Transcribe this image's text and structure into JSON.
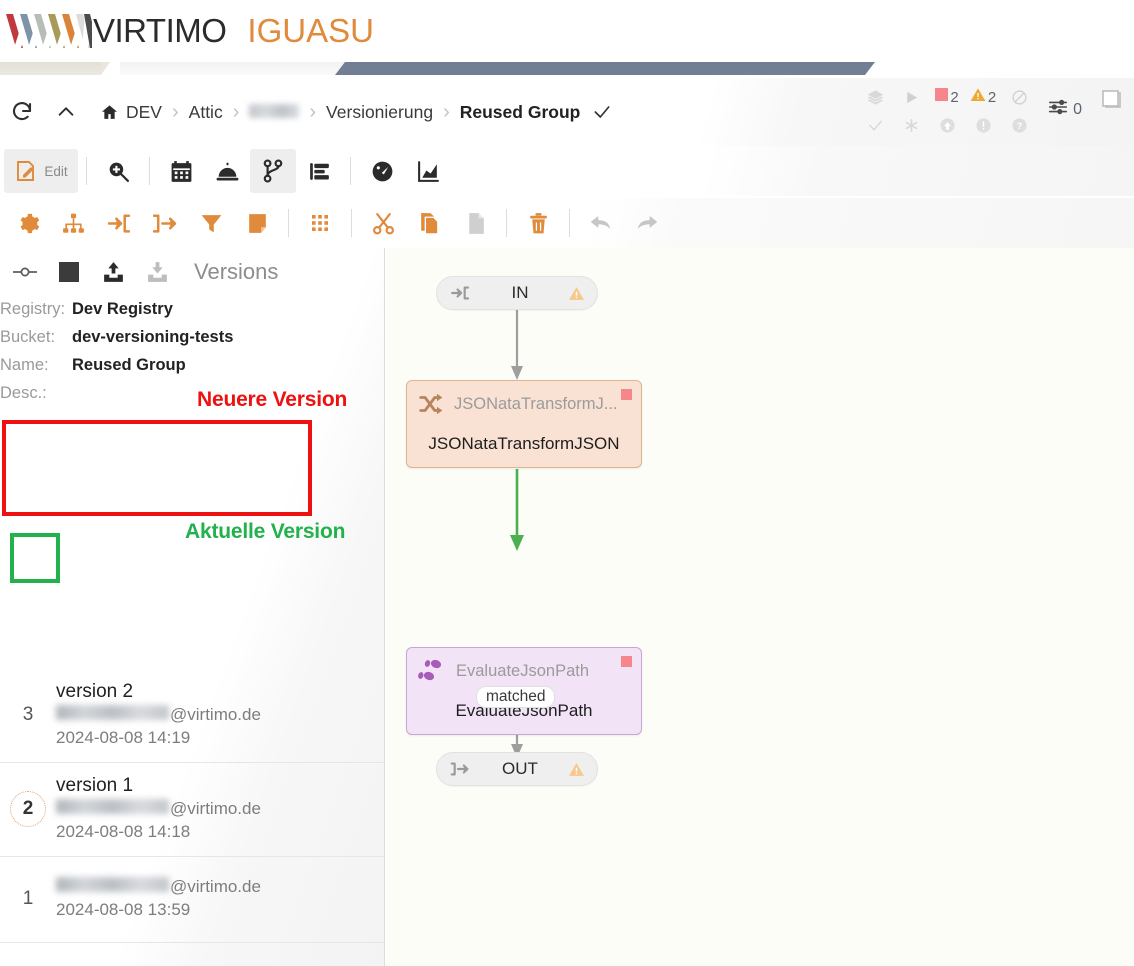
{
  "brand": {
    "name": "VIRTIMO",
    "product": "IGUASU",
    "logo_icon": "virtimo-zigzag-logo",
    "accent_color": "#e08a3c"
  },
  "header": {
    "refresh_icon": "refresh-icon",
    "collapse_icon": "chevron-up-icon",
    "home_icon": "home-icon",
    "breadcrumb": [
      {
        "label": "DEV",
        "redacted": false
      },
      {
        "label": "Attic",
        "redacted": false
      },
      {
        "label": "",
        "redacted": true
      },
      {
        "label": "Versionierung",
        "redacted": false
      },
      {
        "label": "Reused Group",
        "redacted": false,
        "current": true
      }
    ],
    "breadcrumb_check_icon": "check-icon",
    "separator": "›"
  },
  "status": {
    "row1": [
      {
        "icon": "layers-icon",
        "value": ""
      },
      {
        "icon": "play-icon",
        "value": ""
      },
      {
        "icon": "stopped-square-icon",
        "value": "2",
        "color": "#f4868c"
      },
      {
        "icon": "warning-triangle-icon",
        "value": "2",
        "color": "#f0a830"
      },
      {
        "icon": "disabled-circle-icon",
        "value": ""
      }
    ],
    "row2": [
      {
        "icon": "check-icon",
        "value": ""
      },
      {
        "icon": "asterisk-icon",
        "value": ""
      },
      {
        "icon": "arrow-up-circle-icon",
        "value": ""
      },
      {
        "icon": "exclamation-circle-icon",
        "value": ""
      },
      {
        "icon": "question-circle-icon",
        "value": ""
      }
    ],
    "sliders": {
      "icon": "sliders-icon",
      "value": "0"
    },
    "window_icon": "window-copy-icon"
  },
  "toolbar_primary": [
    {
      "name": "edit",
      "label": "Edit",
      "icon": "pencil-note-icon",
      "active": false
    },
    {
      "name": "separator",
      "label": "",
      "icon": "separator",
      "active": false
    },
    {
      "name": "search",
      "label": "",
      "icon": "zoom-in-icon",
      "active": false
    },
    {
      "name": "separator",
      "label": "",
      "icon": "separator",
      "active": false
    },
    {
      "name": "schedule",
      "label": "",
      "icon": "calendar-icon",
      "active": false
    },
    {
      "name": "services",
      "label": "",
      "icon": "service-bell-icon",
      "active": false
    },
    {
      "name": "versions",
      "label": "",
      "icon": "branch-icon",
      "active": true
    },
    {
      "name": "outline",
      "label": "",
      "icon": "list-indent-icon",
      "active": false
    },
    {
      "name": "separator",
      "label": "",
      "icon": "separator",
      "active": false
    },
    {
      "name": "monitor",
      "label": "",
      "icon": "gauge-icon",
      "active": false
    },
    {
      "name": "statistics",
      "label": "",
      "icon": "area-chart-icon",
      "active": false
    }
  ],
  "toolbar_secondary": [
    {
      "name": "settings",
      "icon": "gear-icon",
      "enabled": true
    },
    {
      "name": "hierarchy",
      "icon": "sitemap-icon",
      "enabled": true
    },
    {
      "name": "input-port",
      "icon": "arrow-into-bracket-icon",
      "enabled": true
    },
    {
      "name": "output-port",
      "icon": "arrow-outof-bracket-icon",
      "enabled": true
    },
    {
      "name": "filter",
      "icon": "funnel-icon",
      "enabled": true
    },
    {
      "name": "note",
      "icon": "sticky-note-icon",
      "enabled": true
    },
    {
      "name": "separator",
      "icon": "separator",
      "enabled": true
    },
    {
      "name": "grid",
      "icon": "dot-grid-icon",
      "enabled": true
    },
    {
      "name": "separator",
      "icon": "separator",
      "enabled": true
    },
    {
      "name": "cut",
      "icon": "scissors-icon",
      "enabled": true
    },
    {
      "name": "copy",
      "icon": "copy-icon",
      "enabled": true
    },
    {
      "name": "paste",
      "icon": "paste-icon",
      "enabled": false
    },
    {
      "name": "separator",
      "icon": "separator",
      "enabled": true
    },
    {
      "name": "delete",
      "icon": "trash-icon",
      "enabled": true
    },
    {
      "name": "separator",
      "icon": "separator",
      "enabled": true
    },
    {
      "name": "undo",
      "icon": "undo-arrow-icon",
      "enabled": false
    },
    {
      "name": "redo",
      "icon": "redo-arrow-icon",
      "enabled": false
    }
  ],
  "versions_panel": {
    "title": "Versions",
    "head_buttons": [
      {
        "name": "toggle-line",
        "icon": "commit-line-icon",
        "enabled": true
      },
      {
        "name": "stop",
        "icon": "stop-square-icon",
        "enabled": true
      },
      {
        "name": "commit-upload",
        "icon": "upload-tray-icon",
        "enabled": true
      },
      {
        "name": "checkout-download",
        "icon": "download-tray-icon",
        "enabled": false
      }
    ],
    "meta": [
      {
        "key": "Registry:",
        "value": "Dev Registry"
      },
      {
        "key": "Bucket:",
        "value": "dev-versioning-tests"
      },
      {
        "key": "Name:",
        "value": "Reused Group"
      },
      {
        "key": "Desc.:",
        "value": ""
      }
    ],
    "versions": [
      {
        "number": "3",
        "title": "version 2",
        "email_prefix_redacted": true,
        "email_domain": "@virtimo.de",
        "date": "2024-08-08 14:19",
        "current": false,
        "highlight": "red"
      },
      {
        "number": "2",
        "title": "version 1",
        "email_prefix_redacted": true,
        "email_domain": "@virtimo.de",
        "date": "2024-08-08 14:18",
        "current": true,
        "highlight": "green"
      },
      {
        "number": "1",
        "title": "",
        "email_prefix_redacted": true,
        "email_domain": "@virtimo.de",
        "date": "2024-08-08 13:59",
        "current": false,
        "highlight": "none"
      }
    ]
  },
  "annotations": [
    {
      "name": "neuere-version",
      "text": "Neuere Version",
      "color": "#ee1111"
    },
    {
      "name": "aktuelle-version",
      "text": "Aktuelle Version",
      "color": "#22b14c"
    }
  ],
  "flow": {
    "nodes": [
      {
        "id": "in",
        "kind": "io",
        "label": "IN",
        "icon": "arrow-into-bracket-icon",
        "warning_icon": "warning-triangle-icon"
      },
      {
        "id": "jsonata",
        "kind": "processor",
        "type_label": "JSONataTransformJ...",
        "name": "JSONataTransformJSON",
        "icon": "shuffle-icon",
        "badge": "stopped-square-icon",
        "badge_color": "#f4868c",
        "fill": "#f9e2d4"
      },
      {
        "id": "evaljson",
        "kind": "processor",
        "type_label": "EvaluateJsonPath",
        "name": "EvaluateJsonPath",
        "icon": "footprints-icon",
        "badge": "stopped-square-icon",
        "badge_color": "#f4868c",
        "fill": "#f2e3f7"
      },
      {
        "id": "out",
        "kind": "io",
        "label": "OUT",
        "icon": "arrow-outof-bracket-icon",
        "warning_icon": "warning-triangle-icon"
      }
    ],
    "edges": [
      {
        "from": "in",
        "to": "jsonata",
        "label": "",
        "color": "#9e9e9e"
      },
      {
        "from": "jsonata",
        "to": "evaljson",
        "label": "",
        "color": "#4caf50"
      },
      {
        "from": "evaljson",
        "to": "out",
        "label": "matched",
        "color": "#9e9e9e"
      }
    ]
  }
}
